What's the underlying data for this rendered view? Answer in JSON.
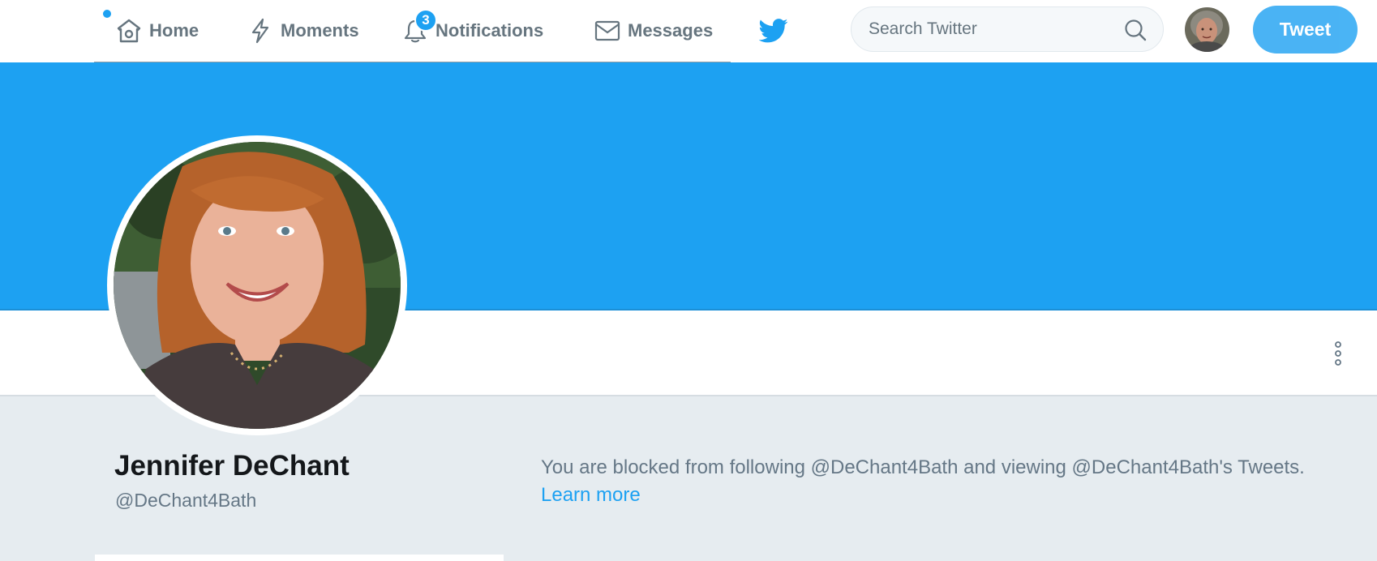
{
  "nav": {
    "home_label": "Home",
    "moments_label": "Moments",
    "notifications_label": "Notifications",
    "notifications_count": "3",
    "messages_label": "Messages"
  },
  "search": {
    "placeholder": "Search Twitter"
  },
  "tweet_button_label": "Tweet",
  "profile": {
    "name": "Jennifer DeChant",
    "handle": "@DeChant4Bath"
  },
  "blocked_notice": {
    "text": "You are blocked from following @DeChant4Bath and viewing @DeChant4Bath's Tweets.",
    "link": "Learn more"
  },
  "colors": {
    "accent": "#1da1f2",
    "background": "#e6ecf0",
    "muted_text": "#657786"
  },
  "icons": [
    "home-icon",
    "moments-icon",
    "notifications-icon",
    "messages-icon",
    "twitter-logo-icon",
    "search-icon",
    "more-icon"
  ]
}
